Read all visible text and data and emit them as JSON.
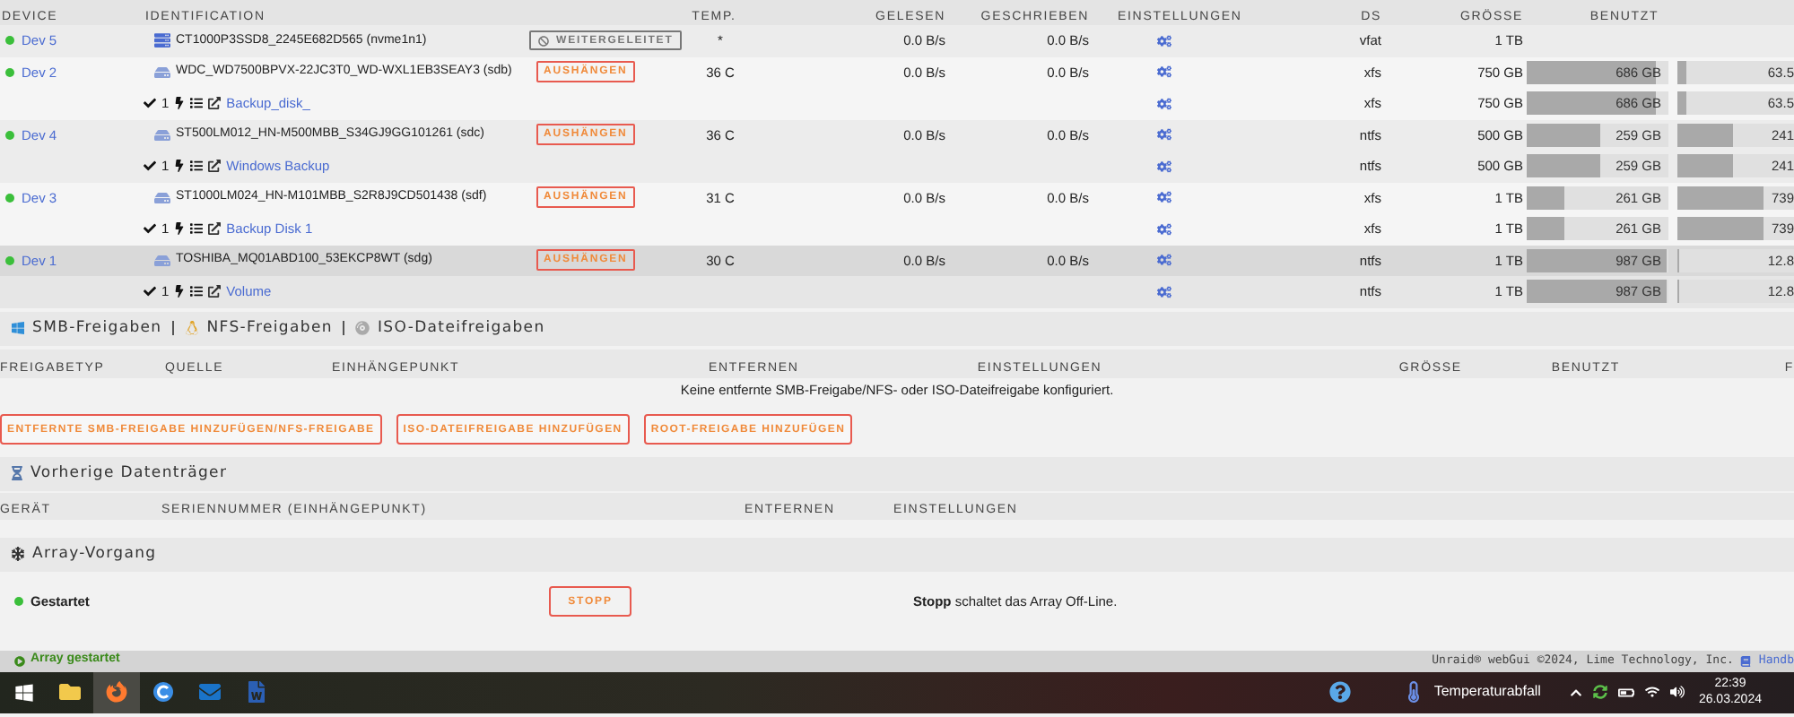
{
  "devices_table": {
    "columns": [
      "DEVICE",
      "IDENTIFICATION",
      "TEMP.",
      "GELESEN",
      "GESCHRIEBEN",
      "EINSTELLUNGEN",
      "DS",
      "GRÖSSE",
      "BENUTZT"
    ],
    "devices": [
      {
        "name": "Dev 5",
        "online": true,
        "selected": false,
        "kind": "nvme",
        "identification": "CT1000P3SSD8_2245E682D565 (nvme1n1)",
        "action": {
          "kind": "forwarded",
          "label": "WEITERGELEITET"
        },
        "temp": "*",
        "read": "0.0 B/s",
        "written": "0.0 B/s",
        "fs": "vfat",
        "size": "1 TB"
      },
      {
        "name": "Dev 2",
        "online": true,
        "selected": false,
        "kind": "hdd",
        "identification": "WDC_WD7500BPVX-22JC3T0_WD-WXL1EB3SEAY3 (sdb)",
        "action": {
          "kind": "unmount",
          "label": "AUSHÄNGEN"
        },
        "temp": "36 C",
        "read": "0.0 B/s",
        "written": "0.0 B/s",
        "fs": "xfs",
        "size": "750 GB",
        "used": {
          "value": "686 GB",
          "level": 0.915
        },
        "free": {
          "value": "63.5",
          "level": 0.08
        },
        "partitions": [
          {
            "count": "1",
            "label": "Backup_disk_",
            "fs": "xfs",
            "size": "750 GB",
            "used": {
              "value": "686 GB",
              "level": 0.915
            },
            "free": {
              "value": "63.5",
              "level": 0.08
            }
          }
        ]
      },
      {
        "name": "Dev 4",
        "online": true,
        "selected": false,
        "kind": "hdd",
        "identification": "ST500LM012_HN-M500MBB_S34GJ9GG101261 (sdc)",
        "action": {
          "kind": "unmount",
          "label": "AUSHÄNGEN"
        },
        "temp": "36 C",
        "read": "0.0 B/s",
        "written": "0.0 B/s",
        "fs": "ntfs",
        "size": "500 GB",
        "used": {
          "value": "259 GB",
          "level": 0.52
        },
        "free": {
          "value": "241",
          "level": 0.48
        },
        "partitions": [
          {
            "count": "1",
            "label": "Windows Backup",
            "fs": "ntfs",
            "size": "500 GB",
            "used": {
              "value": "259 GB",
              "level": 0.52
            },
            "free": {
              "value": "241",
              "level": 0.48
            }
          }
        ]
      },
      {
        "name": "Dev 3",
        "online": true,
        "selected": false,
        "kind": "hdd",
        "identification": "ST1000LM024_HN-M101MBB_S2R8J9CD501438 (sdf)",
        "action": {
          "kind": "unmount",
          "label": "AUSHÄNGEN"
        },
        "temp": "31 C",
        "read": "0.0 B/s",
        "written": "0.0 B/s",
        "fs": "xfs",
        "size": "1 TB",
        "used": {
          "value": "261 GB",
          "level": 0.26
        },
        "free": {
          "value": "739",
          "level": 0.74
        },
        "partitions": [
          {
            "count": "1",
            "label": "Backup Disk 1",
            "fs": "xfs",
            "size": "1 TB",
            "used": {
              "value": "261 GB",
              "level": 0.26
            },
            "free": {
              "value": "739",
              "level": 0.74
            }
          }
        ]
      },
      {
        "name": "Dev 1",
        "online": true,
        "selected": true,
        "kind": "hdd",
        "identification": "TOSHIBA_MQ01ABD100_53EKCP8WT (sdg)",
        "action": {
          "kind": "unmount",
          "label": "AUSHÄNGEN"
        },
        "temp": "30 C",
        "read": "0.0 B/s",
        "written": "0.0 B/s",
        "fs": "ntfs",
        "size": "1 TB",
        "used": {
          "value": "987 GB",
          "level": 0.987
        },
        "free": {
          "value": "12.8",
          "level": 0.01
        },
        "partitions": [
          {
            "count": "1",
            "label": "Volume",
            "fs": "ntfs",
            "size": "1 TB",
            "used": {
              "value": "987 GB",
              "level": 0.987
            },
            "free": {
              "value": "12.8",
              "level": 0.01
            }
          }
        ]
      }
    ]
  },
  "shares": {
    "tabs": [
      {
        "kind": "smb",
        "label": "SMB-Freigaben"
      },
      {
        "kind": "nfs",
        "label": "NFS-Freigaben"
      },
      {
        "kind": "iso",
        "label": "ISO-Dateifreigaben"
      }
    ],
    "columns": [
      "FREIGABETYP",
      "QUELLE",
      "EINHÄNGEPUNKT",
      "ENTFERNEN",
      "EINSTELLUNGEN",
      "GRÖSSE",
      "BENUTZT",
      "F"
    ],
    "empty_message": "Keine entfernte SMB-Freigabe/NFS- oder ISO-Dateifreigabe konfiguriert.",
    "buttons": [
      "ENTFERNTE SMB-FREIGABE HINZUFÜGEN/NFS-FREIGABE",
      "ISO-DATEIFREIGABE HINZUFÜGEN",
      "ROOT-FREIGABE HINZUFÜGEN"
    ]
  },
  "previous_disks": {
    "title": "Vorherige Datenträger",
    "columns": [
      "GERÄT",
      "SERIENNUMMER (EINHÄNGEPUNKT)",
      "ENTFERNEN",
      "EINSTELLUNGEN"
    ]
  },
  "array_operation": {
    "title": "Array-Vorgang",
    "status": "Gestartet",
    "started": true,
    "button": "STOPP",
    "description": "**Stopp** schaltet das Array Off-Line."
  },
  "status_bar": {
    "array_status": "Array gestartet",
    "copyright": "Unraid® webGui ©2024, Lime Technology, Inc.",
    "manual_link": "Handb"
  },
  "taskbar": {
    "apps": [
      {
        "kind": "start",
        "selected": false
      },
      {
        "kind": "explorer",
        "selected": false
      },
      {
        "kind": "firefox",
        "selected": true
      },
      {
        "kind": "cclient",
        "selected": false
      },
      {
        "kind": "outlook",
        "selected": false
      },
      {
        "kind": "word",
        "selected": false
      }
    ],
    "weather": "Temperaturabfall",
    "time": "22:39",
    "date": "26.03.2024"
  }
}
